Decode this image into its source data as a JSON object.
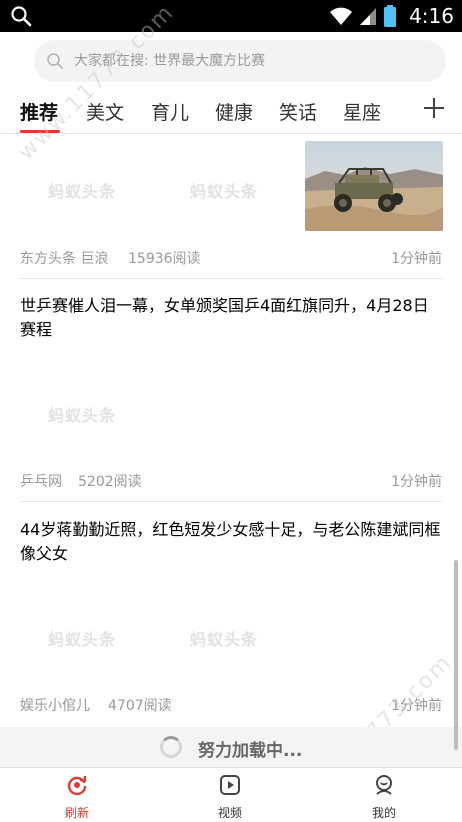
{
  "status_bar": {
    "time": "4:16",
    "search_icon": "search-icon",
    "wifi_icon": "wifi-icon",
    "signal_icon": "signal-icon",
    "battery_icon": "battery-icon"
  },
  "search": {
    "placeholder": "大家都在搜: 世界最大魔方比赛"
  },
  "tabs": [
    {
      "label": "推荐",
      "active": true
    },
    {
      "label": "美文"
    },
    {
      "label": "育儿"
    },
    {
      "label": "健康"
    },
    {
      "label": "笑话"
    },
    {
      "label": "星座"
    }
  ],
  "accent_color": "#e23b2e",
  "articles": [
    {
      "watermarks": [
        "蚂蚁头条",
        "蚂蚁头条"
      ],
      "source": "东方头条 巨浪",
      "reads": "15936阅读",
      "time": "1分钟前",
      "thumbnail": "off-road-buggy-photo"
    },
    {
      "title": "世乒赛催人泪一幕，女单颁奖国乒4面红旗同升，4月28日赛程",
      "watermarks": [
        "蚂蚁头条"
      ],
      "source": "乒乓网",
      "reads": "5202阅读",
      "time": "1分钟前"
    },
    {
      "title": "44岁蒋勤勤近照，红色短发少女感十足，与老公陈建斌同框像父女",
      "watermarks": [
        "蚂蚁头条",
        "蚂蚁头条"
      ],
      "source": "娱乐小倌儿",
      "reads": "4707阅读",
      "time": "1分钟前"
    }
  ],
  "loading": {
    "text": "努力加载中..."
  },
  "site_watermark": "www.11773.com",
  "bottom_nav": [
    {
      "label": "刷新",
      "icon": "refresh-icon",
      "active": true
    },
    {
      "label": "视频",
      "icon": "video-icon"
    },
    {
      "label": "我的",
      "icon": "profile-icon"
    }
  ]
}
